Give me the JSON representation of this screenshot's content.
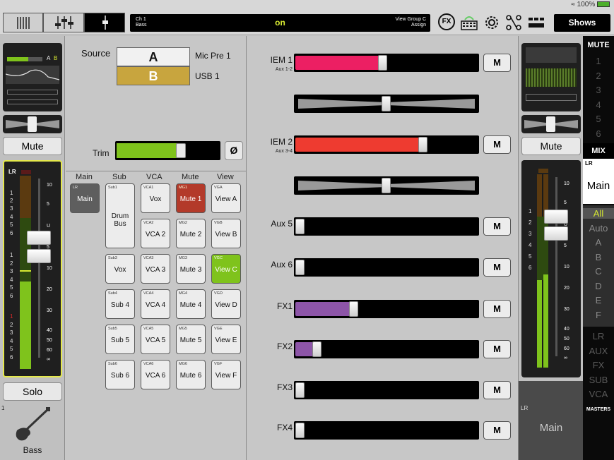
{
  "status": {
    "battery": "100%"
  },
  "topbar": {
    "lcd": {
      "channel": "Ch 1",
      "channel_name": "Bass",
      "state": "on",
      "view_group": "View Group C",
      "assign": "Assign"
    },
    "fx_label": "FX",
    "shows_label": "Shows"
  },
  "left_strip": {
    "mute_label": "Mute",
    "solo_label": "Solo",
    "meter_title": "LR",
    "meter_scale": [
      "10",
      "5",
      "U",
      "5",
      "10",
      "20",
      "30",
      "40",
      "50",
      "60",
      "∞"
    ],
    "meter_numbers": [
      "1",
      "2",
      "3",
      "4",
      "5",
      "6",
      "1",
      "2",
      "3",
      "4",
      "5",
      "6",
      "1",
      "2",
      "3",
      "4",
      "5",
      "6"
    ],
    "channel_number": "1",
    "channel_name": "Bass",
    "mini_labels": [
      "A",
      "B"
    ]
  },
  "source": {
    "label": "Source",
    "a": "A",
    "b": "B",
    "a_input": "Mic Pre 1",
    "b_input": "USB 1",
    "trim_label": "Trim",
    "trim_level": 0.62,
    "phase_label": "Ø"
  },
  "assign_grid": {
    "headers": [
      "Main",
      "Sub",
      "VCA",
      "Mute",
      "View"
    ],
    "main": {
      "tiny": "LR",
      "label": "Main"
    },
    "sub": [
      {
        "tiny": "Sub1",
        "label": "Drum Bus"
      },
      {
        "tiny": "Sub3",
        "label": "Vox"
      },
      {
        "tiny": "Sub4",
        "label": "Sub 4"
      },
      {
        "tiny": "Sub5",
        "label": "Sub 5"
      },
      {
        "tiny": "Sub6",
        "label": "Sub 6"
      }
    ],
    "vca": [
      {
        "tiny": "VCA1",
        "label": "Vox"
      },
      {
        "tiny": "VCA2",
        "label": "VCA 2"
      },
      {
        "tiny": "VCA3",
        "label": "VCA 3"
      },
      {
        "tiny": "VCA4",
        "label": "VCA 4"
      },
      {
        "tiny": "VCA5",
        "label": "VCA 5"
      },
      {
        "tiny": "VCA6",
        "label": "VCA 6"
      }
    ],
    "mute": [
      {
        "tiny": "MG1",
        "label": "Mute 1"
      },
      {
        "tiny": "MG2",
        "label": "Mute 2"
      },
      {
        "tiny": "MG3",
        "label": "Mute 3"
      },
      {
        "tiny": "MG4",
        "label": "Mute 4"
      },
      {
        "tiny": "MG5",
        "label": "Mute 5"
      },
      {
        "tiny": "MG6",
        "label": "Mute 6"
      }
    ],
    "view": [
      {
        "tiny": "VGA",
        "label": "View A"
      },
      {
        "tiny": "VGB",
        "label": "View B"
      },
      {
        "tiny": "VGC",
        "label": "View C"
      },
      {
        "tiny": "VGD",
        "label": "View D"
      },
      {
        "tiny": "VGE",
        "label": "View E"
      },
      {
        "tiny": "VGF",
        "label": "View F"
      }
    ]
  },
  "mixes": {
    "m_label": "M",
    "rows": [
      {
        "name": "IEM 1",
        "sub": "Aux 1-2",
        "level": 0.48,
        "color": "#ec1f63",
        "pan": 0.5
      },
      {
        "name": "IEM 2",
        "sub": "Aux 3-4",
        "level": 0.7,
        "color": "#ee3b30",
        "pan": 0.5
      },
      {
        "name": "Aux 5",
        "sub": "",
        "level": 0.0,
        "color": "#000000"
      },
      {
        "name": "Aux 6",
        "sub": "",
        "level": 0.0,
        "color": "#000000"
      },
      {
        "name": "FX1",
        "sub": "",
        "level": 0.32,
        "color": "#8d55a8"
      },
      {
        "name": "FX2",
        "sub": "",
        "level": 0.12,
        "color": "#8d55a8"
      },
      {
        "name": "FX3",
        "sub": "",
        "level": 0.0,
        "color": "#000000"
      },
      {
        "name": "FX4",
        "sub": "",
        "level": 0.0,
        "color": "#000000"
      }
    ]
  },
  "right_strip": {
    "mute_label": "Mute",
    "mix_title": "LR",
    "mix_name": "Main",
    "meter_numbers": [
      "1",
      "2",
      "3",
      "4",
      "5",
      "6"
    ],
    "meter_scale": [
      "10",
      "5",
      "U",
      "5",
      "10",
      "20",
      "30",
      "40",
      "50",
      "60",
      "∞"
    ],
    "footer_title": "LR",
    "footer_name": "Main"
  },
  "far_right": {
    "mute_header": "MUTE",
    "mute_numbers": [
      "1",
      "2",
      "3",
      "4",
      "5",
      "6"
    ],
    "mix_header": "MIX",
    "views": [
      "All",
      "Auto",
      "A",
      "B",
      "C",
      "D",
      "E",
      "F"
    ],
    "layers": [
      "LR",
      "AUX",
      "FX",
      "SUB",
      "VCA"
    ],
    "masters_label": "MASTERS"
  }
}
